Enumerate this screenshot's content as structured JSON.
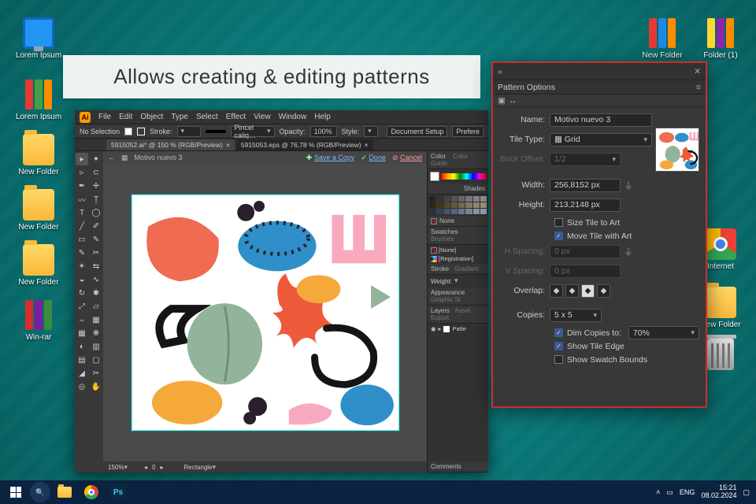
{
  "callout": "Allows creating & editing patterns",
  "desktop": {
    "left": [
      {
        "label": "Lorem Ipsum",
        "type": "monitor"
      },
      {
        "label": "Lorem Ipsum",
        "type": "books"
      },
      {
        "label": "New Folder",
        "type": "folder"
      },
      {
        "label": "New Folder",
        "type": "folder"
      },
      {
        "label": "New Folder",
        "type": "folder"
      },
      {
        "label": "Win-rar",
        "type": "winrar"
      }
    ],
    "right": [
      {
        "label": "New Folder",
        "type": "books"
      },
      {
        "label": "Folder (1)",
        "type": "books2"
      },
      {
        "label": "Internet",
        "type": "chrome"
      },
      {
        "label": "New Folder",
        "type": "folder"
      },
      {
        "label": "",
        "type": "trash"
      }
    ]
  },
  "ai": {
    "menus": [
      "File",
      "Edit",
      "Object",
      "Type",
      "Select",
      "Effect",
      "View",
      "Window",
      "Help"
    ],
    "control": {
      "selection": "No Selection",
      "stroke_label": "Stroke:",
      "brush": "Pincel calig…",
      "opacity_label": "Opacity:",
      "opacity_value": "100%",
      "style_label": "Style:",
      "doc_setup": "Document Setup",
      "prefs": "Prefere"
    },
    "tabs": [
      {
        "label": "5915052.ai* @ 150 % (RGB/Preview)",
        "active": true
      },
      {
        "label": "5915053.eps @ 76,78 % (RGB/Preview)",
        "active": false
      }
    ],
    "pattern_bar": {
      "crumb": "Motivo nuevo 3",
      "save": "Save a Copy",
      "done": "Done",
      "cancel": "Cancel"
    },
    "panels": {
      "color": "Color",
      "color_guide": "Color Guide",
      "shades": "Shades",
      "none": "None",
      "swatches": "Swatches",
      "brushes": "Brushes",
      "layer_names": [
        "[None]",
        "[Registration]"
      ],
      "stroke": "Stroke",
      "gradient": "Gradient",
      "weight": "Weight:",
      "appearance": "Appearance",
      "graphic_styles": "Graphic St",
      "layers": "Layers",
      "asset_export": "Asset Export",
      "layer1": "Patte"
    },
    "status": {
      "zoom": "150%",
      "tool": "Rectangle"
    },
    "comments": "Comments"
  },
  "pattern": {
    "title": "Pattern Options",
    "name_label": "Name:",
    "name": "Motivo nuevo 3",
    "tile_label": "Tile Type:",
    "tile": "Grid",
    "brick_label": "Brick Offset:",
    "brick": "1/2",
    "width_label": "Width:",
    "width": "256,8152 px",
    "height_label": "Height:",
    "height": "213,2148 px",
    "size_tile": "Size Tile to Art",
    "move_tile": "Move Tile with Art",
    "hspace_label": "H Spacing:",
    "hspace": "0 px",
    "vspace_label": "V Spacing:",
    "vspace": "0 px",
    "overlap_label": "Overlap:",
    "copies_label": "Copies:",
    "copies": "5 x 5",
    "dim_label": "Dim Copies to:",
    "dim": "70%",
    "show_edge": "Show Tile Edge",
    "show_swatch": "Show Swatch Bounds"
  },
  "taskbar": {
    "lang": "ENG",
    "time": "15:21",
    "date": "08.02.2024",
    "ps": "Ps"
  }
}
